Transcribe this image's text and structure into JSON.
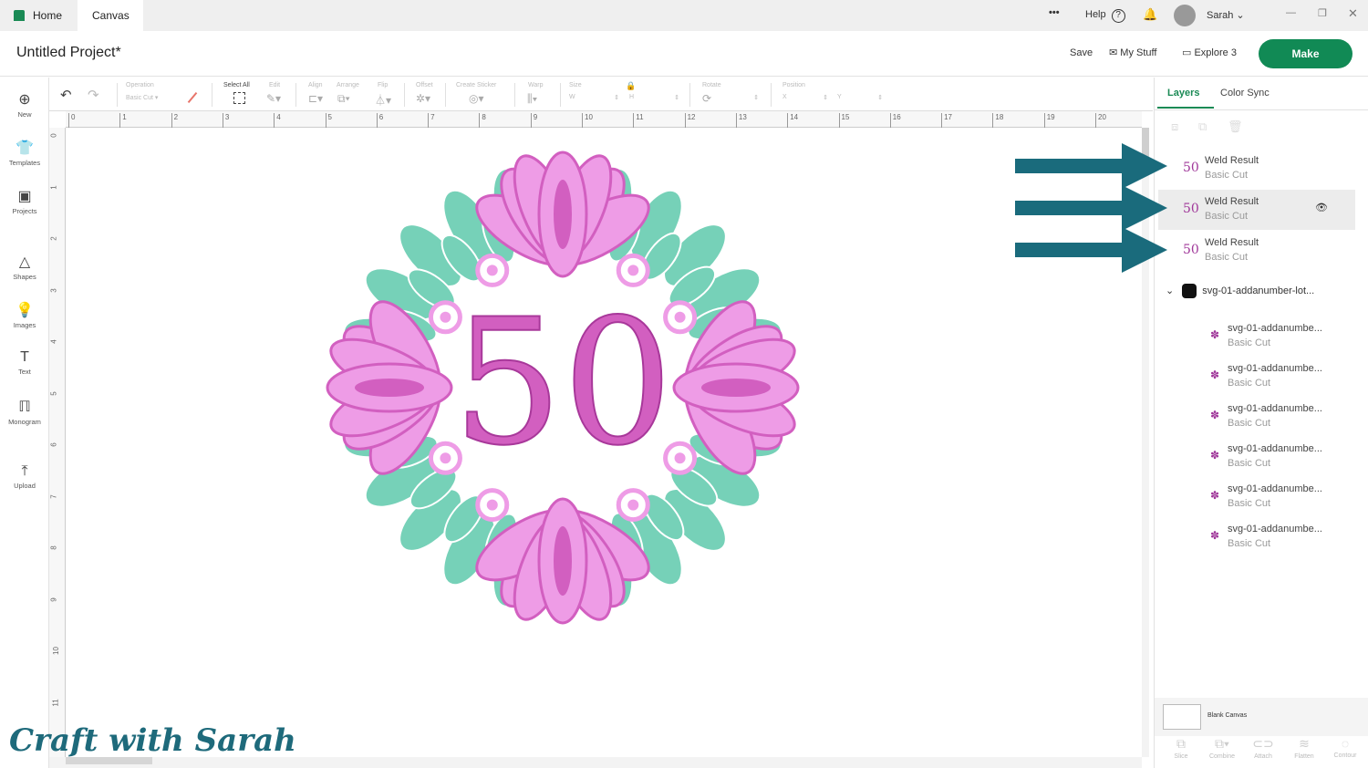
{
  "tabs": {
    "home": "Home",
    "canvas": "Canvas"
  },
  "topbar": {
    "more": "•••",
    "help": "Help",
    "help_icon": "?",
    "user": "Sarah"
  },
  "header": {
    "title": "Untitled Project*",
    "save": "Save",
    "my_stuff": "My Stuff",
    "machine": "Explore 3",
    "make": "Make"
  },
  "toolbar": {
    "operation_label": "Operation",
    "operation_value": "Basic Cut",
    "select_all": "Select All",
    "edit": "Edit",
    "align": "Align",
    "arrange": "Arrange",
    "flip": "Flip",
    "offset": "Offset",
    "create_sticker": "Create Sticker",
    "warp": "Warp",
    "size": "Size",
    "w": "W",
    "h": "H",
    "rotate": "Rotate",
    "position": "Position",
    "x": "X",
    "y": "Y"
  },
  "sidebar": [
    {
      "label": "New",
      "icon": "⊕"
    },
    {
      "label": "Templates",
      "icon": "👕"
    },
    {
      "label": "Projects",
      "icon": "▣"
    },
    {
      "label": "Shapes",
      "icon": "△"
    },
    {
      "label": "Images",
      "icon": "💡"
    },
    {
      "label": "Text",
      "icon": "T"
    },
    {
      "label": "Monogram",
      "icon": "ℿ"
    },
    {
      "label": "Upload",
      "icon": "⤒"
    }
  ],
  "ruler_x": [
    "0",
    "1",
    "2",
    "3",
    "4",
    "5",
    "6",
    "7",
    "8",
    "9",
    "10",
    "11",
    "12",
    "13",
    "14",
    "15",
    "16",
    "17",
    "18",
    "19",
    "20"
  ],
  "ruler_y": [
    "0",
    "1",
    "2",
    "3",
    "4",
    "5",
    "6",
    "7",
    "8",
    "9",
    "10",
    "11"
  ],
  "artwork": {
    "text": "50",
    "pink": "#d25fc0",
    "light_pink": "#ee9ce6",
    "teal": "#76d1b8"
  },
  "panel": {
    "tab_layers": "Layers",
    "tab_color_sync": "Color Sync",
    "layers": [
      {
        "name": "Weld Result",
        "op": "Basic Cut"
      },
      {
        "name": "Weld Result",
        "op": "Basic Cut"
      },
      {
        "name": "Weld Result",
        "op": "Basic Cut"
      }
    ],
    "group": "svg-01-addanumber-lot...",
    "children": [
      {
        "name": "svg-01-addanumbe...",
        "op": "Basic Cut"
      },
      {
        "name": "svg-01-addanumbe...",
        "op": "Basic Cut"
      },
      {
        "name": "svg-01-addanumbe...",
        "op": "Basic Cut"
      },
      {
        "name": "svg-01-addanumbe...",
        "op": "Basic Cut"
      },
      {
        "name": "svg-01-addanumbe...",
        "op": "Basic Cut"
      },
      {
        "name": "svg-01-addanumbe...",
        "op": "Basic Cut"
      }
    ],
    "blank_canvas": "Blank Canvas",
    "actions": [
      {
        "label": "Slice",
        "icon": "⧉"
      },
      {
        "label": "Combine",
        "icon": "⧉▾"
      },
      {
        "label": "Attach",
        "icon": "⊂⊃"
      },
      {
        "label": "Flatten",
        "icon": "≋"
      },
      {
        "label": "Contour",
        "icon": "◌"
      }
    ]
  },
  "watermark": "Craft with Sarah",
  "arrow_color": "#1a6b7c"
}
